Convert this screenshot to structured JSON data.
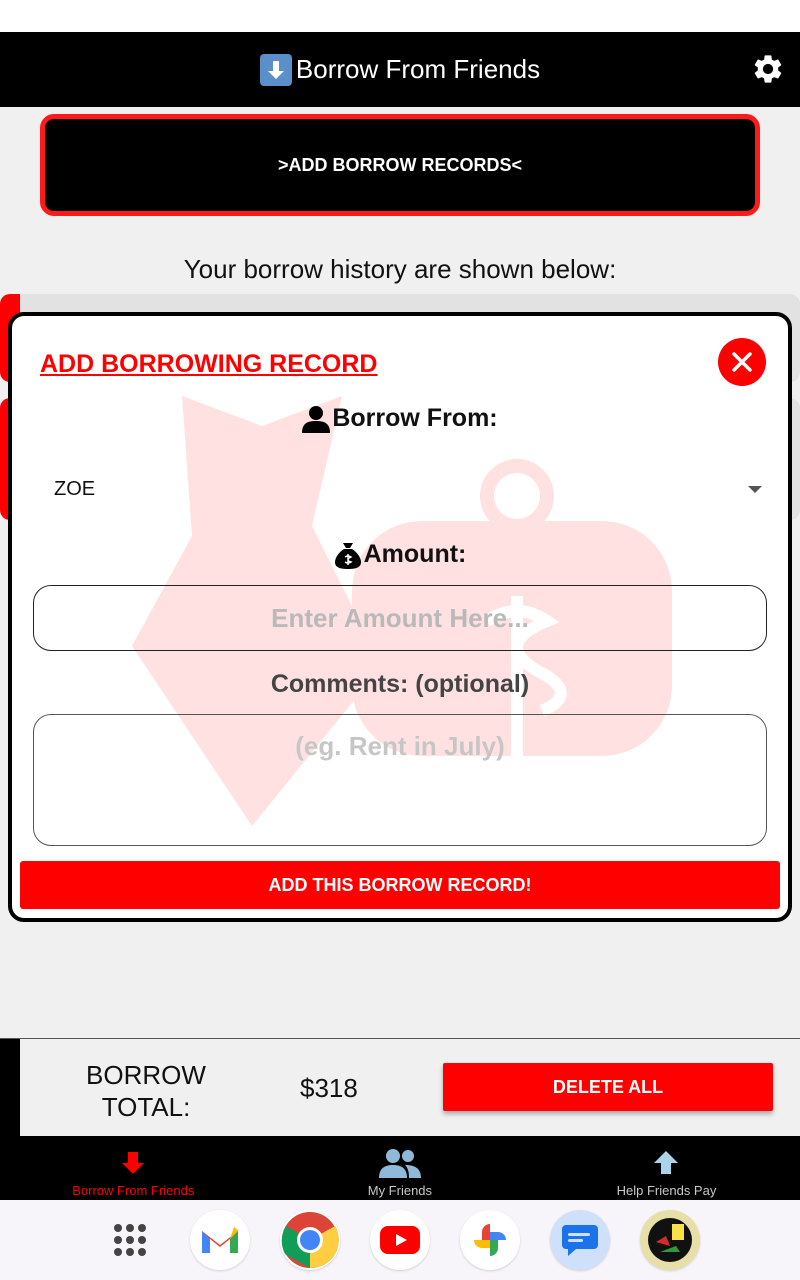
{
  "header": {
    "title": "Borrow From Friends",
    "title_icon": "down-arrow-emoji-icon",
    "settings_icon": "gear-icon"
  },
  "main": {
    "add_records_label": ">ADD BORROW RECORDS<",
    "history_caption": "Your borrow history are shown below:"
  },
  "modal": {
    "title": "ADD BORROWING RECORD",
    "borrow_from_label": "Borrow From:",
    "borrow_from_value": "ZOE",
    "amount_label": "Amount:",
    "amount_placeholder": "Enter Amount Here...",
    "comments_label": "Comments: (optional)",
    "comments_placeholder": "(eg. Rent in July)",
    "submit_label": "ADD THIS BORROW RECORD!"
  },
  "totals": {
    "label": "BORROW TOTAL:",
    "value": "$318",
    "delete_label": "DELETE ALL"
  },
  "nav": {
    "items": [
      {
        "label": "Borrow From Friends",
        "icon": "down-arrow-icon",
        "active": true
      },
      {
        "label": "My Friends",
        "icon": "people-icon",
        "active": false
      },
      {
        "label": "Help Friends Pay",
        "icon": "up-arrow-icon",
        "active": false
      }
    ]
  },
  "dock": {
    "apps": [
      "app-drawer-icon",
      "gmail-icon",
      "chrome-icon",
      "youtube-icon",
      "photos-icon",
      "messages-icon",
      "borrow-app-icon"
    ]
  },
  "colors": {
    "accent": "#ff0000",
    "header_bg": "#000000",
    "nav_inactive": "#c8c8c8"
  }
}
